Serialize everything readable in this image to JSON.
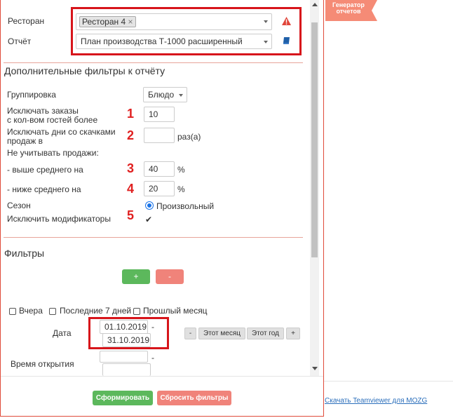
{
  "side_badge": {
    "line1": "Генератор",
    "line2": "отчетов"
  },
  "report_form": {
    "restaurant_label": "Ресторан",
    "restaurant_tag": "Ресторан 4",
    "report_label": "Отчёт",
    "report_value": "План производства Т-1000 расширенный"
  },
  "extra_filters": {
    "title": "Дополнительные фильтры к отчёту",
    "grouping_label": "Группировка",
    "grouping_value": "Блюдо",
    "exclude_orders_label_1": "Исключать заказы",
    "exclude_orders_label_2": "с кол-вом гостей более",
    "exclude_orders_value": "10",
    "exclude_days_label_1": "Исключать дни со скачками",
    "exclude_days_label_2": "продаж в",
    "exclude_days_value": "",
    "exclude_days_unit": "раз(а)",
    "ignore_sales_label": "Не учитывать продажи:",
    "above_avg_label": "- выше среднего на",
    "above_avg_value": "40",
    "below_avg_label": "- ниже среднего на",
    "below_avg_value": "20",
    "percent": "%",
    "season_label": "Сезон",
    "season_option": "Произвольный",
    "exclude_mods_label": "Исключить модификаторы"
  },
  "markers": [
    "1",
    "2",
    "3",
    "4",
    "5"
  ],
  "filters": {
    "title": "Фильтры",
    "add_label": "+",
    "remove_label": "-",
    "yesterday": "Вчера",
    "last7": "Последние 7 дней",
    "last_month": "Прошлый месяц",
    "date_label": "Дата",
    "date_from": "01.10.2019",
    "date_to": "31.10.2019",
    "dash": "-",
    "btn_minus": "-",
    "btn_this_month": "Этот месяц",
    "btn_this_year": "Этот год",
    "btn_plus": "+",
    "open_time_label": "Время открытия"
  },
  "actions": {
    "generate": "Сформировать",
    "reset": "Сбросить фильтры"
  },
  "footer": {
    "teamviewer_link": "Скачать Teamviewer для MOZG"
  },
  "colors": {
    "accent_red": "#d7151b",
    "green": "#5cb85c",
    "salmon": "#f0837a",
    "badge": "#f58b76"
  }
}
